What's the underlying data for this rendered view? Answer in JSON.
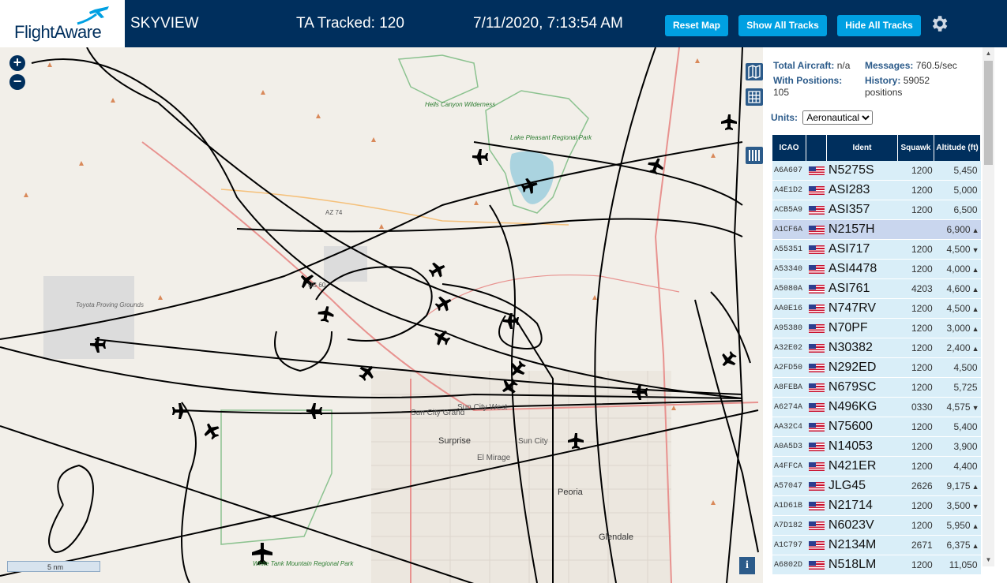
{
  "header": {
    "logo_text": "FlightAware",
    "app_name": "SKYVIEW",
    "tracked": "TA Tracked: 120",
    "datetime": "7/11/2020, 7:13:54 AM",
    "reset_map": "Reset Map",
    "show_tracks": "Show All Tracks",
    "hide_tracks": "Hide All Tracks"
  },
  "map": {
    "zoom_in": "+",
    "zoom_out": "−",
    "scale_label": "5 nm",
    "info": "i",
    "labels": {
      "hells_canyon": "Hells Canyon Wilderness",
      "lake_pleasant": "Lake Pleasant Regional Park",
      "toyota": "Toyota Proving Grounds",
      "white_tank": "White Tank Mountain Regional Park",
      "az74": "AZ 74",
      "us60": "US 60",
      "sun_city_west": "Sun City West",
      "sun_city_grand": "Sun City Grand",
      "sun_city": "Sun City",
      "surprise": "Surprise",
      "el_mirage": "El Mirage",
      "peoria": "Peoria",
      "glendale": "Glendale"
    }
  },
  "stats": {
    "total_label": "Total Aircraft:",
    "total_value": "n/a",
    "positions_label": "With Positions:",
    "positions_value": "105",
    "messages_label": "Messages:",
    "messages_value": "760.5/sec",
    "history_label": "History:",
    "history_value": "59052",
    "history_unit": "positions"
  },
  "units": {
    "label": "Units:",
    "selected": "Aeronautical"
  },
  "table": {
    "headers": {
      "icao": "ICAO",
      "ident": "Ident",
      "squawk": "Squawk",
      "altitude": "Altitude (ft)"
    },
    "rows": [
      {
        "icao": "A6A607",
        "ident": "N5275S",
        "squawk": "1200",
        "alt": "5,450",
        "trend": ""
      },
      {
        "icao": "A4E1D2",
        "ident": "ASI283",
        "squawk": "1200",
        "alt": "5,000",
        "trend": ""
      },
      {
        "icao": "ACB5A9",
        "ident": "ASI357",
        "squawk": "1200",
        "alt": "6,500",
        "trend": ""
      },
      {
        "icao": "A1CF6A",
        "ident": "N2157H",
        "squawk": "",
        "alt": "6,900",
        "trend": "▲"
      },
      {
        "icao": "A55351",
        "ident": "ASI717",
        "squawk": "1200",
        "alt": "4,500",
        "trend": "▼"
      },
      {
        "icao": "A53340",
        "ident": "ASI4478",
        "squawk": "1200",
        "alt": "4,000",
        "trend": "▲"
      },
      {
        "icao": "A5080A",
        "ident": "ASI761",
        "squawk": "4203",
        "alt": "4,600",
        "trend": "▲"
      },
      {
        "icao": "AA0E16",
        "ident": "N747RV",
        "squawk": "1200",
        "alt": "4,500",
        "trend": "▲"
      },
      {
        "icao": "A95380",
        "ident": "N70PF",
        "squawk": "1200",
        "alt": "3,000",
        "trend": "▲"
      },
      {
        "icao": "A32E02",
        "ident": "N30382",
        "squawk": "1200",
        "alt": "2,400",
        "trend": "▲"
      },
      {
        "icao": "A2FD50",
        "ident": "N292ED",
        "squawk": "1200",
        "alt": "4,500",
        "trend": ""
      },
      {
        "icao": "A8FEBA",
        "ident": "N679SC",
        "squawk": "1200",
        "alt": "5,725",
        "trend": ""
      },
      {
        "icao": "A6274A",
        "ident": "N496KG",
        "squawk": "0330",
        "alt": "4,575",
        "trend": "▼"
      },
      {
        "icao": "AA32C4",
        "ident": "N75600",
        "squawk": "1200",
        "alt": "5,400",
        "trend": ""
      },
      {
        "icao": "A0A5D3",
        "ident": "N14053",
        "squawk": "1200",
        "alt": "3,900",
        "trend": ""
      },
      {
        "icao": "A4FFCA",
        "ident": "N421ER",
        "squawk": "1200",
        "alt": "4,400",
        "trend": ""
      },
      {
        "icao": "A57047",
        "ident": "JLG45",
        "squawk": "2626",
        "alt": "9,175",
        "trend": "▲"
      },
      {
        "icao": "A1D61B",
        "ident": "N21714",
        "squawk": "1200",
        "alt": "3,500",
        "trend": "▼"
      },
      {
        "icao": "A7D182",
        "ident": "N6023V",
        "squawk": "1200",
        "alt": "5,950",
        "trend": "▲"
      },
      {
        "icao": "A1C797",
        "ident": "N2134M",
        "squawk": "2671",
        "alt": "6,375",
        "trend": "▲"
      },
      {
        "icao": "A6802D",
        "ident": "N518LM",
        "squawk": "1200",
        "alt": "11,050",
        "trend": ""
      }
    ]
  },
  "colors": {
    "header_bg": "#002f5d",
    "button_bg": "#00a0e2",
    "row_bg": "#d9eef8",
    "row_selected": "#c9d6ee",
    "track": "#000000"
  }
}
